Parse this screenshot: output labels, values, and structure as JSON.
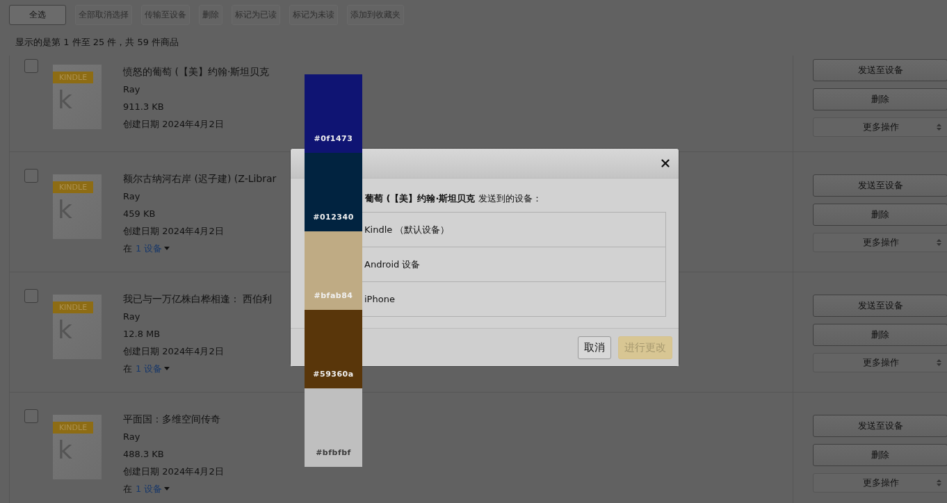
{
  "toolbar": [
    {
      "label": "全选",
      "disabled": false
    },
    {
      "label": "全部取消选择",
      "disabled": true
    },
    {
      "label": "传输至设备",
      "disabled": true
    },
    {
      "label": "删除",
      "disabled": true
    },
    {
      "label": "标记为已读",
      "disabled": true
    },
    {
      "label": "标记为未读",
      "disabled": true
    },
    {
      "label": "添加到收藏夹",
      "disabled": true
    }
  ],
  "count_text": "显示的是第 1 件至 25 件，共 59 件商品",
  "items": [
    {
      "checked": false,
      "cover_badge": "KINDLE",
      "cover_letter": "k",
      "title": "愤怒的葡萄 (【美】约翰·斯坦贝克",
      "author": "Ray",
      "size": "911.3 KB",
      "created": "创建日期 2024年4月2日",
      "actions": [
        "发送至设备",
        "删除"
      ],
      "more": "更多操作"
    },
    {
      "checked": false,
      "cover_badge": "KINDLE",
      "cover_letter": "k",
      "title": "额尔古纳河右岸 (迟子建) (Z-Librar",
      "author": "Ray",
      "size": "459 KB",
      "created": "创建日期 2024年4月2日",
      "device_prefix": "在",
      "device_link": "1 设备",
      "actions": [
        "发送至设备",
        "删除"
      ],
      "more": "更多操作"
    },
    {
      "checked": false,
      "cover_badge": "KINDLE",
      "cover_letter": "k",
      "title": "我已与一万亿株白桦相逢： 西伯利",
      "author": "Ray",
      "size": "12.8 MB",
      "created": "创建日期 2024年4月2日",
      "device_prefix": "在",
      "device_link": "1 设备",
      "actions": [
        "发送至设备",
        "删除"
      ],
      "more": "更多操作"
    },
    {
      "checked": false,
      "cover_badge": "KINDLE",
      "cover_letter": "k",
      "title": "平面国：多维空间传奇",
      "author": "Ray",
      "size": "488.3 KB",
      "created": "创建日期 2024年4月2日",
      "device_prefix": "在",
      "device_link": "1 设备",
      "actions": [
        "发送至设备",
        "删除"
      ],
      "more": "更多操作"
    }
  ],
  "dialog": {
    "prompt": "**葡萄 (【美】约翰·斯坦贝克** 发送到的设备：",
    "devices": [
      "Kindle （默认设备）",
      "Android 设备",
      "iPhone"
    ],
    "buttons": [
      {
        "label": "取消",
        "kind": "secondary",
        "disabled": false
      },
      {
        "label": "进行更改",
        "kind": "primary",
        "disabled": true
      }
    ]
  },
  "palette": [
    {
      "color": "#0f1473",
      "label": "#0f1473"
    },
    {
      "color": "#012340",
      "label": "#012340"
    },
    {
      "color": "#bfab84",
      "label": "#bfab84"
    },
    {
      "color": "#59360a",
      "label": "#59360a"
    },
    {
      "color": "#bfbfbf",
      "label": "#bfbfbf"
    }
  ]
}
